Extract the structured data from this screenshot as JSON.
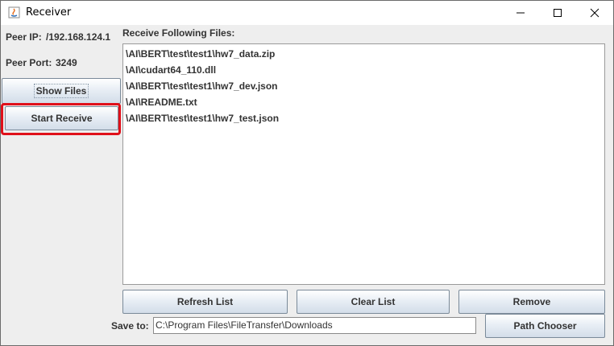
{
  "window": {
    "title": "Receiver",
    "icons": [
      "java-app-icon",
      "minimize-icon",
      "maximize-icon",
      "close-icon"
    ]
  },
  "peer": {
    "ip_label": "Peer IP:",
    "ip_value": "/192.168.124.1",
    "port_label": "Peer Port:",
    "port_value": "3249"
  },
  "left_buttons": {
    "show_files": "Show Files",
    "start_receive": "Start Receive"
  },
  "files": {
    "heading": "Receive Following Files:",
    "items": [
      "\\AI\\BERT\\test\\test1\\hw7_data.zip",
      "\\AI\\cudart64_110.dll",
      "\\AI\\BERT\\test\\test1\\hw7_dev.json",
      "\\AI\\README.txt",
      "\\AI\\BERT\\test\\test1\\hw7_test.json"
    ]
  },
  "list_buttons": {
    "refresh": "Refresh List",
    "clear": "Clear List",
    "remove": "Remove"
  },
  "save": {
    "label": "Save to:",
    "path": "C:\\Program Files\\FileTransfer\\Downloads",
    "chooser": "Path Chooser"
  },
  "colors": {
    "highlight": "#e0101a",
    "panel_bg": "#eeeeee"
  }
}
